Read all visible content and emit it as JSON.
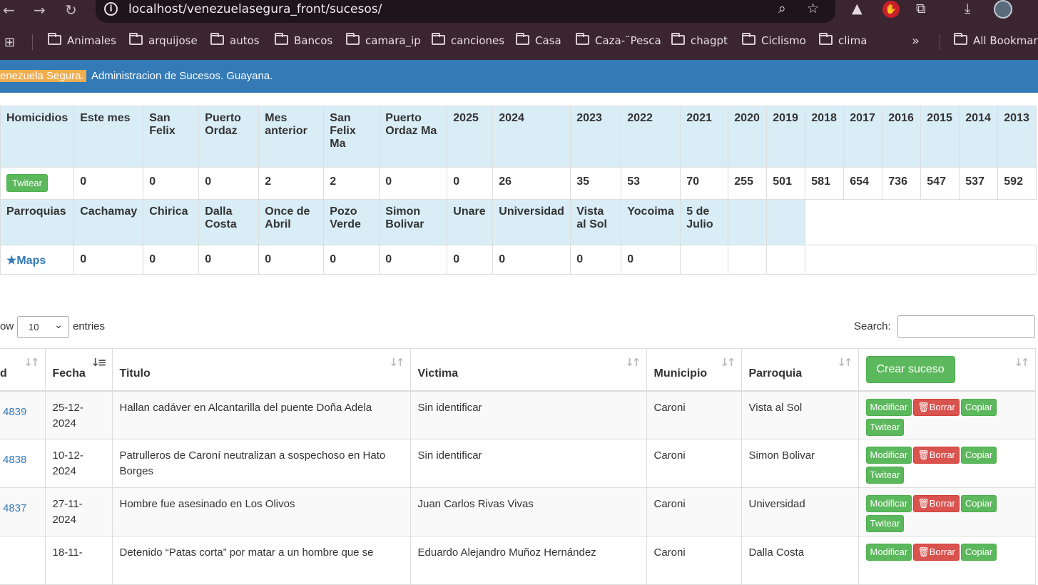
{
  "browser": {
    "url": "localhost/venezuelasegura_front/sucesos/",
    "bookmarks": [
      "Animales",
      "arquijose",
      "autos",
      "Bancos",
      "camara_ip",
      "canciones",
      "Casa",
      "Caza-¨Pesca",
      "chagpt",
      "Ciclismo",
      "clima"
    ],
    "more": "»",
    "all_bookmarks": "All Bookmarks"
  },
  "header": {
    "brand": "enezuela Segura.",
    "text": "Administracion de Sucesos. Guayana."
  },
  "stats": {
    "homicidios_headers": [
      "Homicidios",
      "Este mes",
      "San Felix",
      "Puerto Ordaz",
      "Mes anterior",
      "San Felix Ma",
      "Puerto Ordaz Ma",
      "2025",
      "2024",
      "2023",
      "2022",
      "2021",
      "2020",
      "2019",
      "2018",
      "2017",
      "2016",
      "2015",
      "2014",
      "2013"
    ],
    "twitear_label": "Twitear",
    "homicidios_values": [
      "0",
      "0",
      "0",
      "2",
      "2",
      "0",
      "0",
      "26",
      "35",
      "53",
      "70",
      "255",
      "501",
      "581",
      "654",
      "736",
      "547",
      "537",
      "592"
    ],
    "parroquias_headers": [
      "Parroquias",
      "Cachamay",
      "Chirica",
      "Dalla Costa",
      "Once de Abril",
      "Pozo Verde",
      "Simon Bolivar",
      "Unare",
      "Universidad",
      "Vista al Sol",
      "Yocoima",
      "5 de Julio"
    ],
    "maps_label": "★Maps",
    "parroquias_values": [
      "0",
      "0",
      "0",
      "0",
      "0",
      "0",
      "0",
      "0",
      "0",
      "0"
    ]
  },
  "list_controls": {
    "show_label": "ow",
    "page_length": "10",
    "entries_label": "entries",
    "search_label": "Search:"
  },
  "table": {
    "columns": [
      "d",
      "Fecha",
      "Titulo",
      "Victima",
      "Municipio",
      "Parroquia"
    ],
    "create_button": "Crear suceso",
    "action_labels": {
      "modify": "Modificar",
      "delete": "🗑Borrar",
      "copy": "Copiar",
      "tweet": "Twitear"
    },
    "rows": [
      {
        "id": "4839",
        "fecha": "25-12-2024",
        "titulo": "Hallan cadáver en Alcantarilla del puente Doña Adela",
        "victima": "Sin identificar",
        "municipio": "Caroni",
        "parroquia": "Vista al Sol"
      },
      {
        "id": "4838",
        "fecha": "10-12-2024",
        "titulo": "Patrulleros de Caroní neutralizan a sospechoso en Hato Borges",
        "victima": "Sin identificar",
        "municipio": "Caroni",
        "parroquia": "Simon Bolivar"
      },
      {
        "id": "4837",
        "fecha": "27-11-2024",
        "titulo": "Hombre fue asesinado en Los Olivos",
        "victima": "Juan Carlos Rivas Vivas",
        "municipio": "Caroni",
        "parroquia": "Universidad"
      },
      {
        "id": "",
        "fecha": "18-11-",
        "titulo": "Detenido “Patas corta” por matar a un hombre que se",
        "victima": "Eduardo Alejandro Muñoz Hernández",
        "municipio": "Caroni",
        "parroquia": "Dalla Costa"
      }
    ]
  }
}
